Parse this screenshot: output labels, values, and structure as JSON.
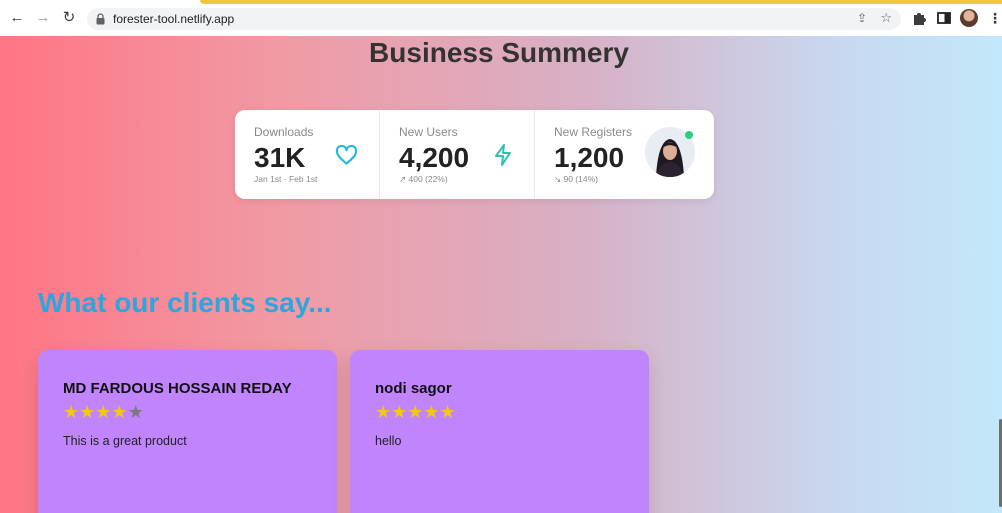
{
  "browser": {
    "url": "forester-tool.netlify.app"
  },
  "page": {
    "title": "Business Summery",
    "stats": [
      {
        "label": "Downloads",
        "value": "31K",
        "sub": "Jan 1st - Feb 1st",
        "icon": "heart-icon"
      },
      {
        "label": "New Users",
        "value": "4,200",
        "sub": "↗ 400 (22%)",
        "icon": "bolt-icon"
      },
      {
        "label": "New Registers",
        "value": "1,200",
        "sub": "↘ 90 (14%)",
        "icon": "profile-avatar"
      }
    ],
    "colors": {
      "heart": "#22b8d6",
      "bolt": "#2fbfb0",
      "section_title": "#2ba6de",
      "card": "#c084fc",
      "online": "#2bd07e"
    },
    "reviews_title": "What our clients say...",
    "reviews": [
      {
        "name": "MD FARDOUS HOSSAIN REDAY",
        "rating": 4,
        "max_rating": 5,
        "text": "This is a great product"
      },
      {
        "name": "nodi sagor",
        "rating": 5,
        "max_rating": 5,
        "text": "hello"
      }
    ]
  }
}
